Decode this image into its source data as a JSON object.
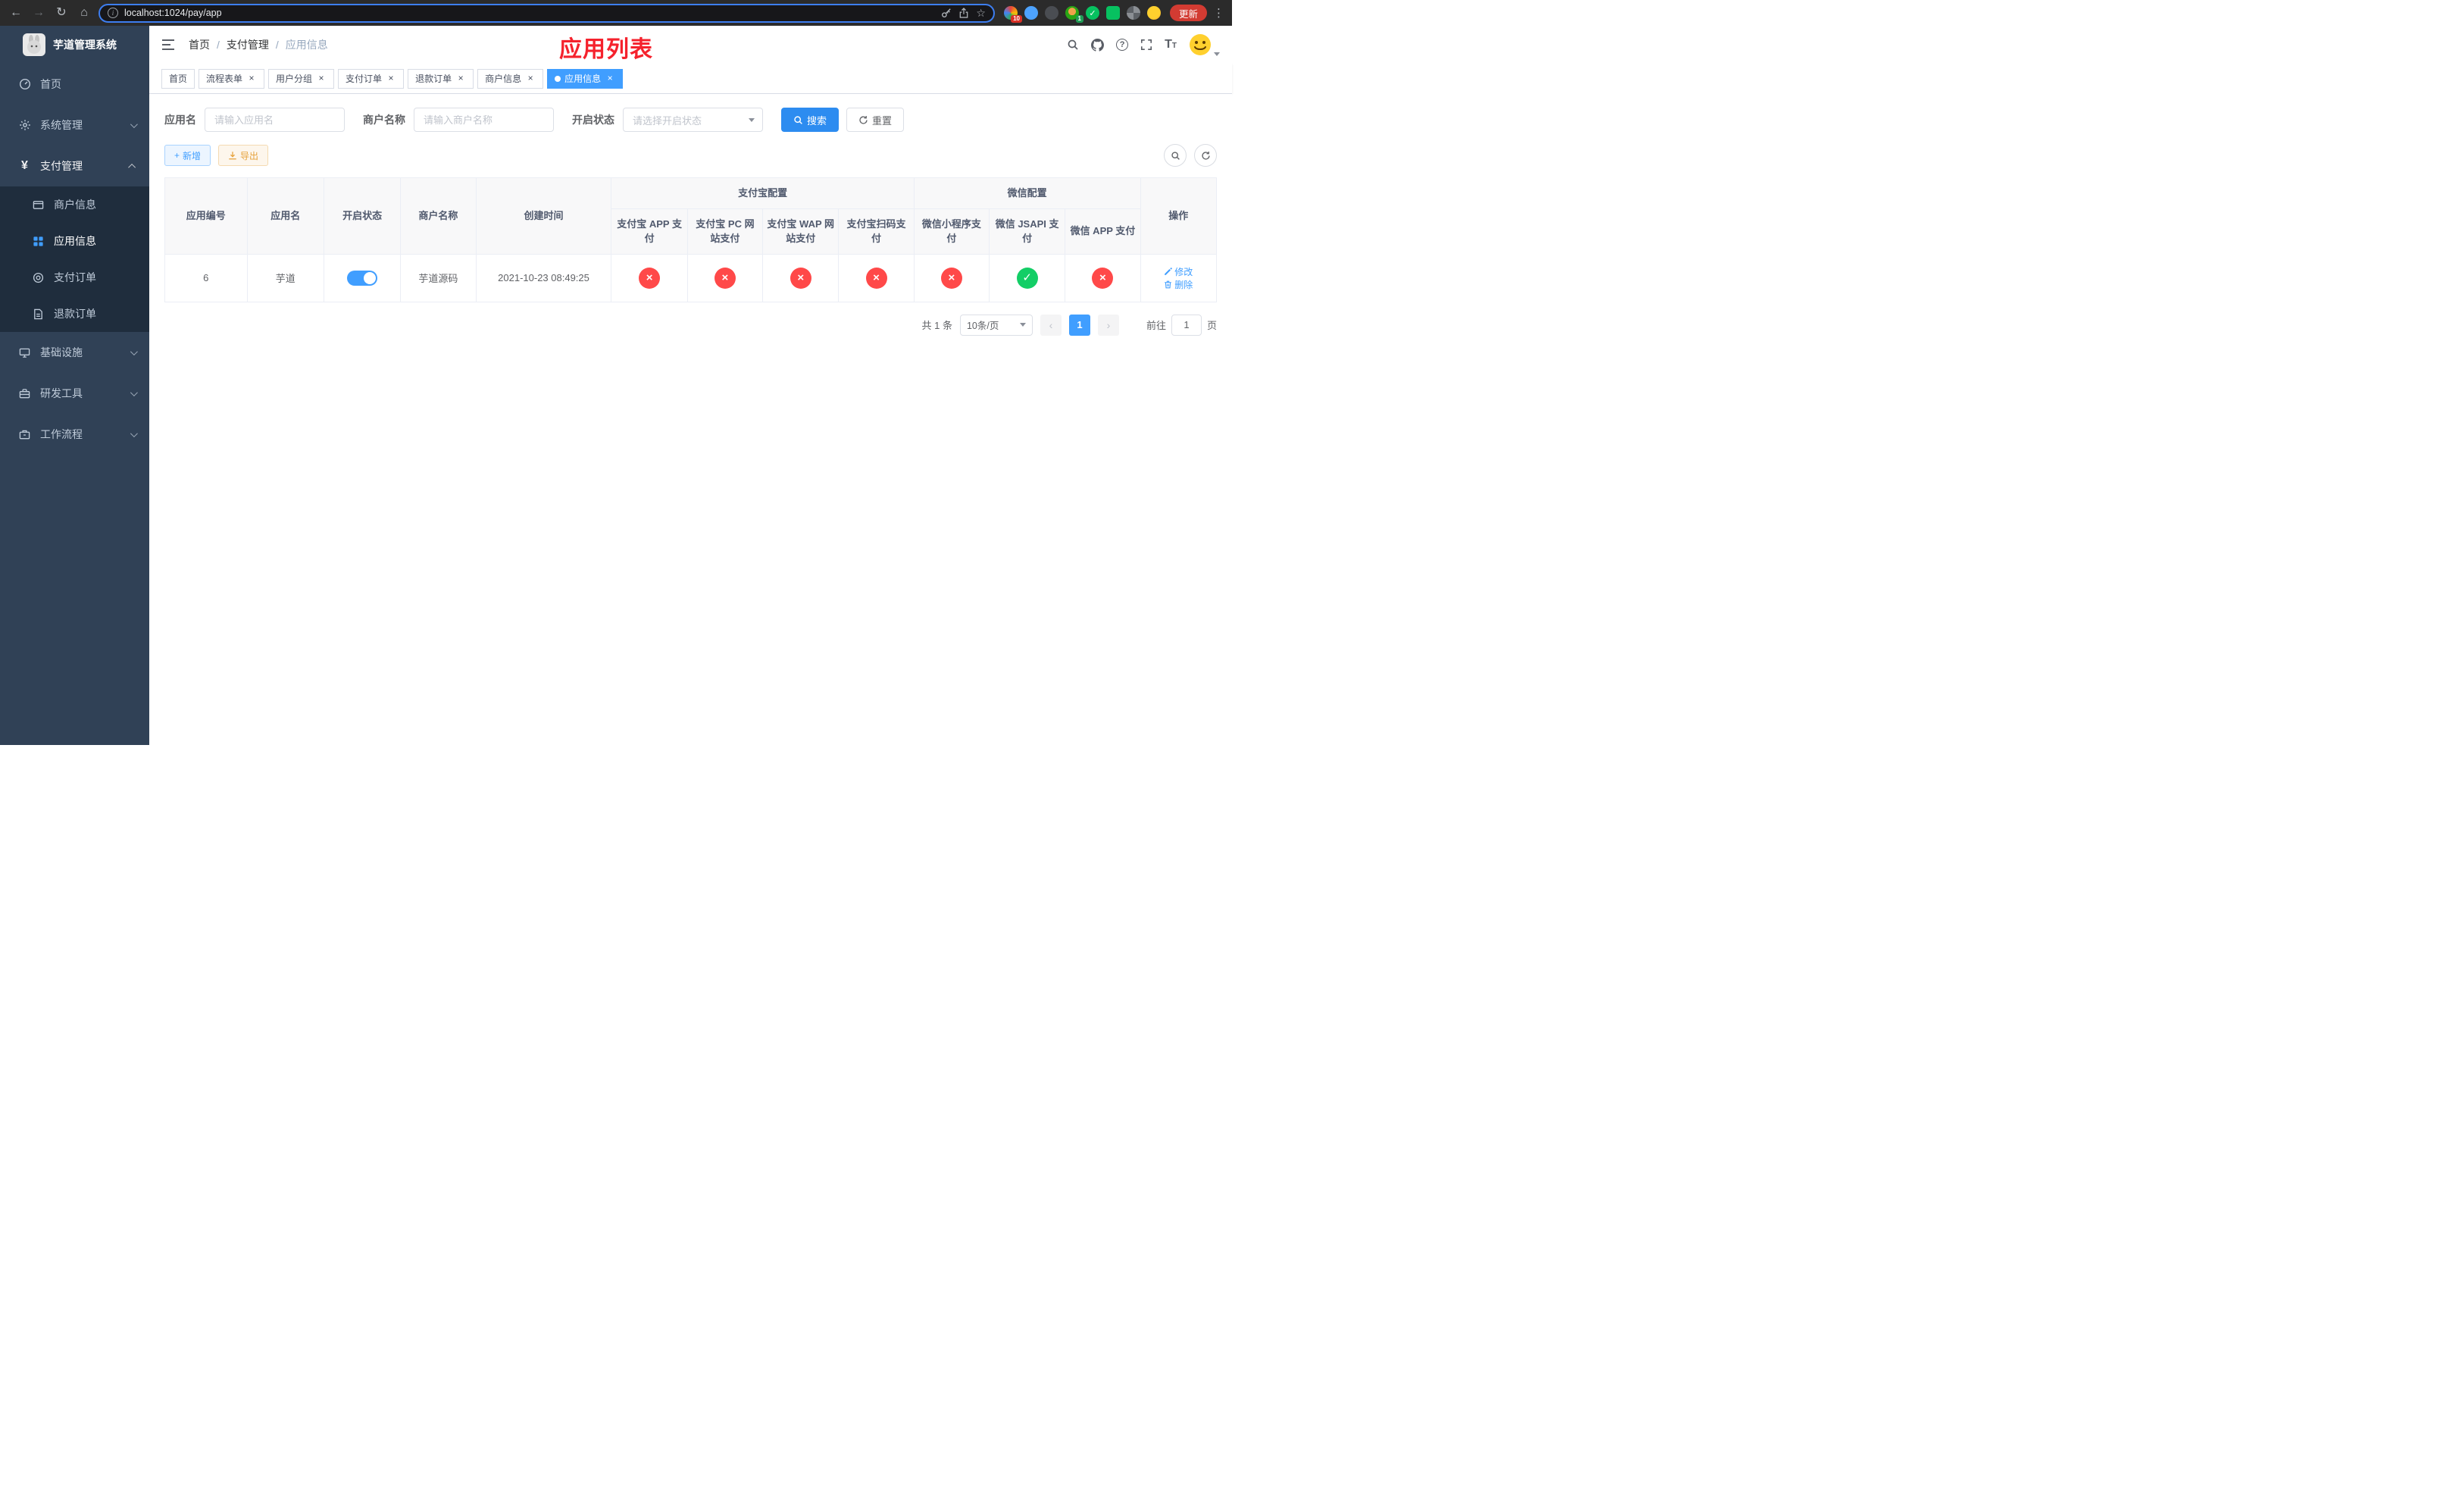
{
  "browser": {
    "url": "localhost:1024/pay/app",
    "update_label": "更新",
    "ext_badge_a": "10",
    "ext_badge_b": "1"
  },
  "sidebar": {
    "title": "芋道管理系统",
    "items": [
      {
        "label": "首页"
      },
      {
        "label": "系统管理"
      },
      {
        "label": "支付管理",
        "children": [
          {
            "label": "商户信息"
          },
          {
            "label": "应用信息"
          },
          {
            "label": "支付订单"
          },
          {
            "label": "退款订单"
          }
        ]
      },
      {
        "label": "基础设施"
      },
      {
        "label": "研发工具"
      },
      {
        "label": "工作流程"
      }
    ]
  },
  "header": {
    "breadcrumb": [
      "首页",
      "支付管理",
      "应用信息"
    ],
    "page_title": "应用列表"
  },
  "tabs": [
    {
      "label": "首页"
    },
    {
      "label": "流程表单"
    },
    {
      "label": "用户分组"
    },
    {
      "label": "支付订单"
    },
    {
      "label": "退款订单"
    },
    {
      "label": "商户信息"
    },
    {
      "label": "应用信息"
    }
  ],
  "filters": {
    "app_name_label": "应用名",
    "app_name_placeholder": "请输入应用名",
    "merchant_label": "商户名称",
    "merchant_placeholder": "请输入商户名称",
    "status_label": "开启状态",
    "status_placeholder": "请选择开启状态",
    "search_label": "搜索",
    "reset_label": "重置"
  },
  "toolbar": {
    "add_label": "新增",
    "export_label": "导出"
  },
  "table": {
    "group_headers": {
      "alipay": "支付宝配置",
      "wechat": "微信配置"
    },
    "columns": [
      "应用编号",
      "应用名",
      "开启状态",
      "商户名称",
      "创建时间",
      "支付宝 APP 支付",
      "支付宝 PC 网站支付",
      "支付宝 WAP 网站支付",
      "支付宝扫码支付",
      "微信小程序支付",
      "微信 JSAPI 支付",
      "微信 APP 支付",
      "操作"
    ],
    "rows": [
      {
        "id": "6",
        "name": "芋道",
        "status_on": true,
        "merchant": "芋道源码",
        "created": "2021-10-23 08:49:25",
        "configs": [
          false,
          false,
          false,
          false,
          false,
          true,
          false
        ],
        "edit_label": "修改",
        "delete_label": "删除"
      }
    ]
  },
  "pagination": {
    "total": "共 1 条",
    "page_size": "10条/页",
    "current_page": "1",
    "prev": "‹",
    "next": "›",
    "goto_label": "前往",
    "goto_value": "1",
    "goto_suffix": "页"
  },
  "icons": {
    "back": "←",
    "forward": "→",
    "reload": "↻",
    "home": "⌂",
    "star": "☆",
    "menu_dots": "⋮",
    "close": "×",
    "check": "✓",
    "question": "?",
    "info": "i",
    "yen": "¥",
    "plus": "+"
  },
  "colors": {
    "accent": "#409eff",
    "sidebar_bg": "#304156",
    "submenu_bg": "#1f2d3d",
    "success": "#13ce66",
    "danger": "#ff4949",
    "warning": "#e6a23c",
    "title_red": "#f5222d"
  }
}
